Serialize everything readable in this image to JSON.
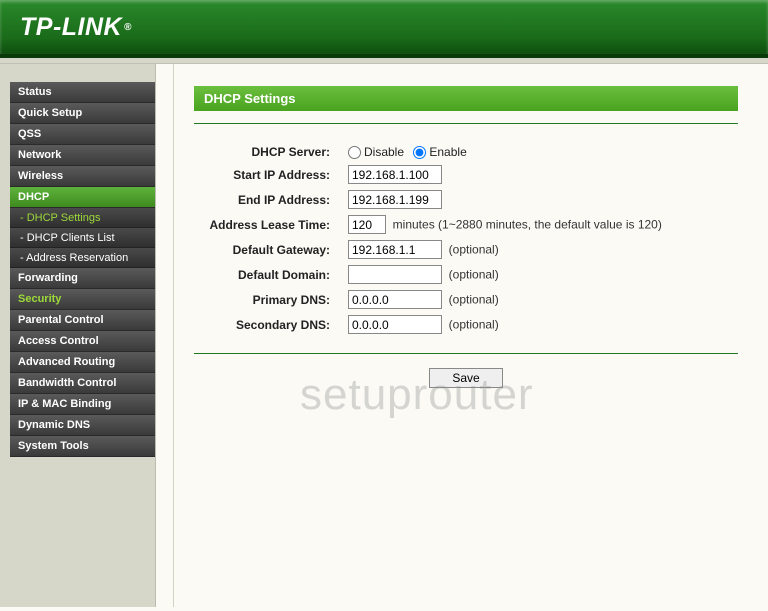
{
  "brand": "TP-LINK",
  "sidebar": {
    "items": [
      {
        "label": "Status",
        "active": false
      },
      {
        "label": "Quick Setup",
        "active": false
      },
      {
        "label": "QSS",
        "active": false
      },
      {
        "label": "Network",
        "active": false
      },
      {
        "label": "Wireless",
        "active": false
      },
      {
        "label": "DHCP",
        "active": true,
        "subs": [
          {
            "label": "- DHCP Settings",
            "active": true
          },
          {
            "label": "- DHCP Clients List",
            "active": false
          },
          {
            "label": "- Address Reservation",
            "active": false
          }
        ]
      },
      {
        "label": "Forwarding",
        "active": false
      },
      {
        "label": "Security",
        "active": false,
        "highlight": true
      },
      {
        "label": "Parental Control",
        "active": false
      },
      {
        "label": "Access Control",
        "active": false
      },
      {
        "label": "Advanced Routing",
        "active": false
      },
      {
        "label": "Bandwidth Control",
        "active": false
      },
      {
        "label": "IP & MAC Binding",
        "active": false
      },
      {
        "label": "Dynamic DNS",
        "active": false
      },
      {
        "label": "System Tools",
        "active": false
      }
    ]
  },
  "panel": {
    "title": "DHCP Settings",
    "labels": {
      "dhcp_server": "DHCP Server:",
      "start_ip": "Start IP Address:",
      "end_ip": "End IP Address:",
      "lease": "Address Lease Time:",
      "gateway": "Default Gateway:",
      "domain": "Default Domain:",
      "pdns": "Primary DNS:",
      "sdns": "Secondary DNS:"
    },
    "radio": {
      "disable": "Disable",
      "enable": "Enable",
      "selected": "enable"
    },
    "values": {
      "start_ip": "192.168.1.100",
      "end_ip": "192.168.1.199",
      "lease": "120",
      "gateway": "192.168.1.1",
      "domain": "",
      "pdns": "0.0.0.0",
      "sdns": "0.0.0.0"
    },
    "notes": {
      "lease": "minutes (1~2880 minutes, the default value is 120)",
      "optional": "(optional)"
    },
    "save": "Save"
  },
  "watermark": "setuprouter"
}
